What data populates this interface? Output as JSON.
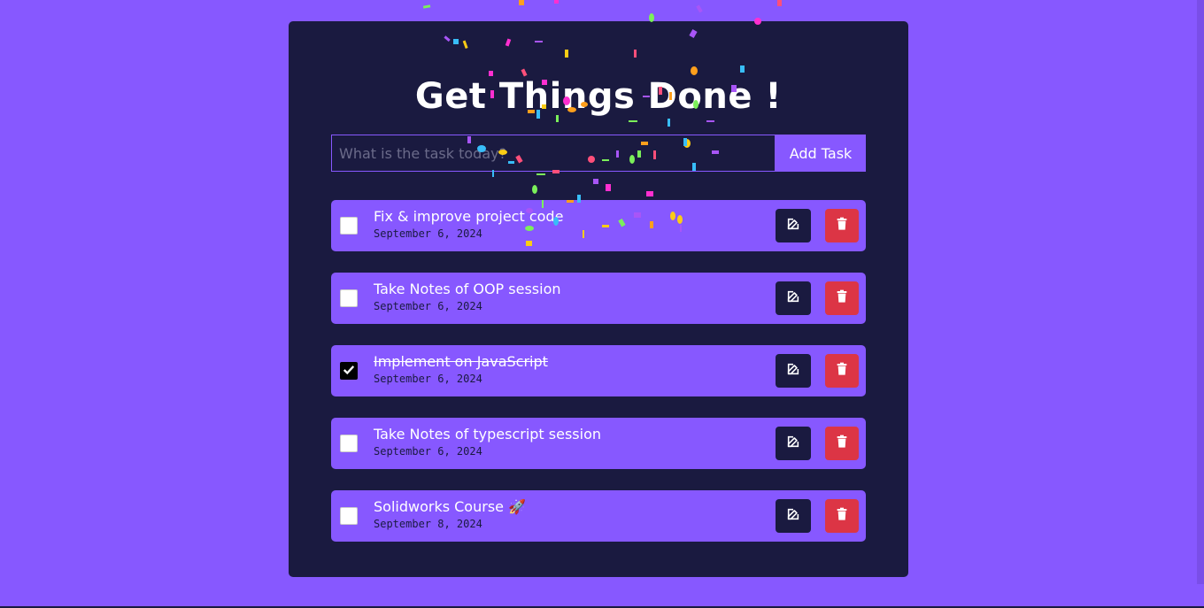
{
  "app": {
    "title": "Get Things Done !"
  },
  "form": {
    "placeholder": "What is the task today?",
    "value": "",
    "add_label": "Add Task"
  },
  "colors": {
    "background": "#8758ff",
    "card": "#1a1a40",
    "accent": "#8758ff",
    "delete": "#dc3545"
  },
  "todos": [
    {
      "text": "Fix & improve project code",
      "date": "September 6, 2024",
      "completed": false
    },
    {
      "text": "Take Notes of OOP session",
      "date": "September 6, 2024",
      "completed": false
    },
    {
      "text": "Implement on JavaScript",
      "date": "September 6, 2024",
      "completed": true
    },
    {
      "text": "Take Notes of typescript session",
      "date": "September 6, 2024",
      "completed": false
    },
    {
      "text": "Solidworks Course 🚀",
      "date": "September 8, 2024",
      "completed": false
    }
  ],
  "icons": {
    "edit": "edit-icon",
    "delete": "trash-icon",
    "check": "check-icon"
  }
}
